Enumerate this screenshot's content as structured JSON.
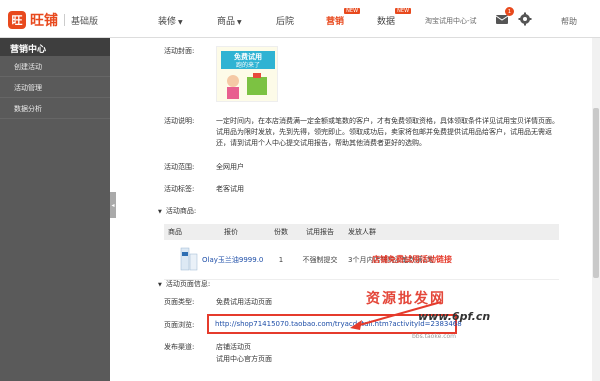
{
  "app": {
    "logo_mark": "旺",
    "logo_name": "旺铺",
    "version": "基础版"
  },
  "nav": {
    "items": [
      {
        "label": "装修",
        "caret": "▼"
      },
      {
        "label": "商品",
        "caret": "▼"
      },
      {
        "label": "后院",
        "caret": ""
      },
      {
        "label": "营销",
        "caret": "",
        "badge": "NEW"
      },
      {
        "label": "数据",
        "caret": "",
        "badge": "NEW"
      }
    ],
    "shop_name": "淘宝试用中心-试",
    "message_count": "1",
    "help": "帮助"
  },
  "sidebar": {
    "title": "营销中心",
    "items": [
      "创建活动",
      "活动管理",
      "数据分析"
    ]
  },
  "detail": {
    "cover_label": "活动封面:",
    "cover_text_line1": "免费试用",
    "cover_text_line2": "跑的来了",
    "desc_label": "活动说明:",
    "desc_text": "一定时间内，在本店消费满一定金额或笔数的客户，才有免费领取资格，具体领取条件详见试用宝贝详情页面。试用品为限时发放，先到先得，领完即止。领取成功后，卖家将包邮并免费提供试用品给客户，试用品无需返还，请到试用个人中心提交试用报告，帮助其他消费者更好的选购。",
    "scope_label": "活动范围:",
    "scope_value": "全网用户",
    "tag_label": "活动标签:",
    "tag_value": "老客试用",
    "goods_section": "活动商品:",
    "page_section": "活动页面信息:",
    "page_type_label": "页面类型:",
    "page_type_value": "免费试用活动页面",
    "page_view_label": "页面浏览:",
    "page_url": "http://shop71415070.taobao.com/tryacdetail.htm?activityId=2383468",
    "channel_label": "发布渠道:",
    "channel_line1": "店铺活动页",
    "channel_line2": "试用中心官方页面"
  },
  "table": {
    "headers": [
      "商品",
      "报价",
      "份数",
      "试用报告",
      "发放人群"
    ],
    "rows": [
      {
        "product": "Olay玉兰油9999.0",
        "copies": "1",
        "report": "不强制提交",
        "audience": "3个月内店铺购买笔数满1笔"
      }
    ]
  },
  "annotation": "店铺免费试用活动链接",
  "watermark": {
    "line1": "资源批发网",
    "line2": "www.6pf.cn",
    "line3": "bbs.taoke.com"
  },
  "colors": {
    "accent": "#e8491d",
    "highlight_red": "#e53b2c",
    "link_blue": "#1f4fa8",
    "sidebar_bg": "#5a5a5a"
  }
}
